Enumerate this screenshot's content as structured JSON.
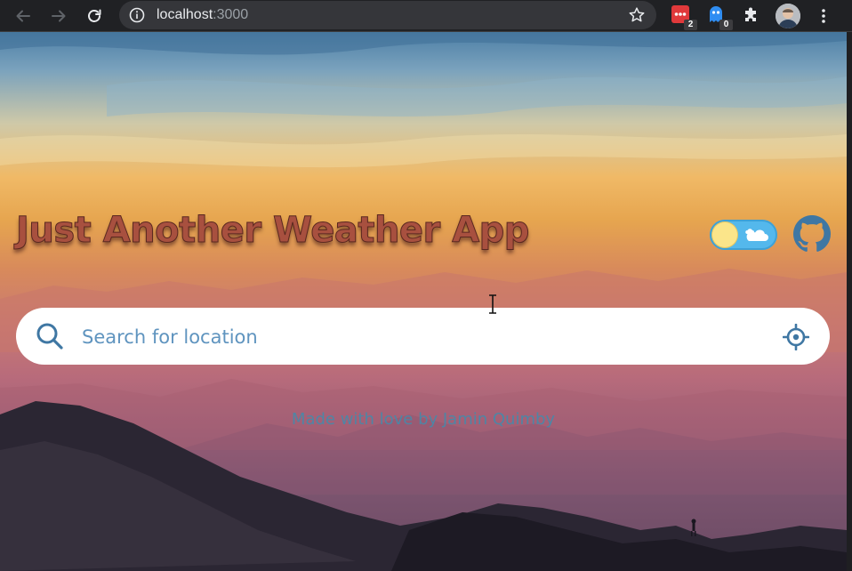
{
  "browser": {
    "url_host": "localhost",
    "url_port": ":3000",
    "extensions": [
      {
        "name": "red-extension-icon",
        "badge": "2",
        "color": "#e0393b"
      },
      {
        "name": "ghost-extension-icon",
        "badge": "0",
        "color": "#2f8df2"
      },
      {
        "name": "puzzle-icon"
      }
    ]
  },
  "app": {
    "title": "Just Another Weather App",
    "theme_toggle": {
      "state": "light",
      "track_color": "#54b8ec",
      "knob_color": "#fbe58a"
    },
    "search": {
      "placeholder": "Search for location",
      "value": ""
    },
    "footer": "Made with love by Jamin Quimby",
    "colors": {
      "title": "#a8503f",
      "search_text": "#5f94bf",
      "icons": "#3f77a3"
    }
  }
}
